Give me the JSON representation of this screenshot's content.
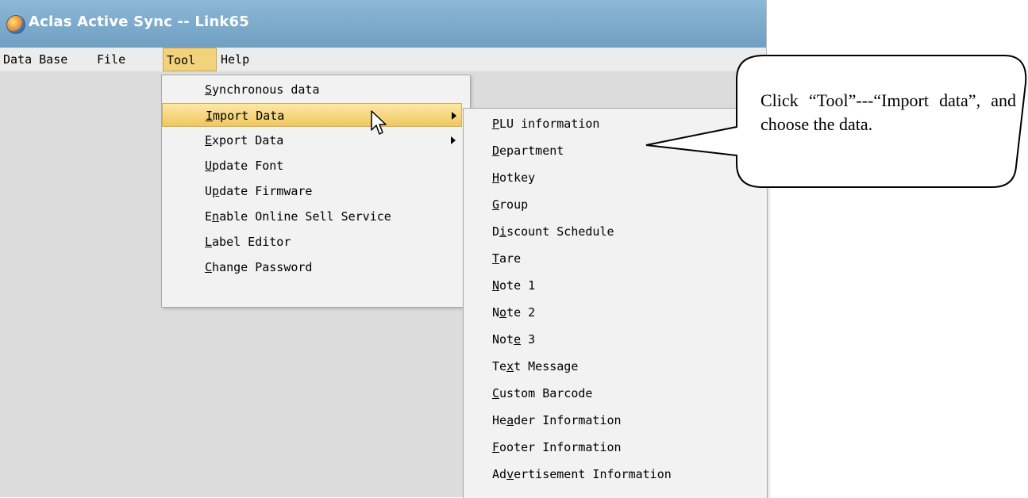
{
  "window": {
    "title": "Aclas Active Sync -- Link65"
  },
  "menubar": [
    "Data Base",
    "File",
    "Tool",
    "Help"
  ],
  "tool_menu": [
    {
      "pre": "",
      "key": "S",
      "post": "ynchronous data"
    },
    {
      "pre": "",
      "key": "I",
      "post": "mport Data"
    },
    {
      "pre": "",
      "key": "E",
      "post": "xport Data"
    },
    {
      "pre": "",
      "key": "U",
      "post": "pdate Font"
    },
    {
      "pre": "U",
      "key": "p",
      "post": "date Firmware"
    },
    {
      "pre": "E",
      "key": "n",
      "post": "able Online Sell Service"
    },
    {
      "pre": "",
      "key": "L",
      "post": "abel Editor"
    },
    {
      "pre": "",
      "key": "C",
      "post": "hange Password"
    }
  ],
  "import_submenu": [
    {
      "pre": "",
      "key": "P",
      "post": "LU information"
    },
    {
      "pre": "",
      "key": "D",
      "post": "epartment"
    },
    {
      "pre": "",
      "key": "H",
      "post": "otkey"
    },
    {
      "pre": "",
      "key": "G",
      "post": "roup"
    },
    {
      "pre": "D",
      "key": "i",
      "post": "scount Schedule"
    },
    {
      "pre": "",
      "key": "T",
      "post": "are"
    },
    {
      "pre": "",
      "key": "N",
      "post": "ote 1"
    },
    {
      "pre": "N",
      "key": "o",
      "post": "te 2"
    },
    {
      "pre": "Not",
      "key": "e",
      "post": " 3"
    },
    {
      "pre": "Te",
      "key": "x",
      "post": "t Message"
    },
    {
      "pre": "",
      "key": "C",
      "post": "ustom Barcode"
    },
    {
      "pre": "He",
      "key": "a",
      "post": "der Information"
    },
    {
      "pre": "",
      "key": "F",
      "post": "ooter Information"
    },
    {
      "pre": "Ad",
      "key": "v",
      "post": "ertisement Information"
    }
  ],
  "callout": {
    "text": "Click “Tool”---“Import data”, and choose the data."
  }
}
